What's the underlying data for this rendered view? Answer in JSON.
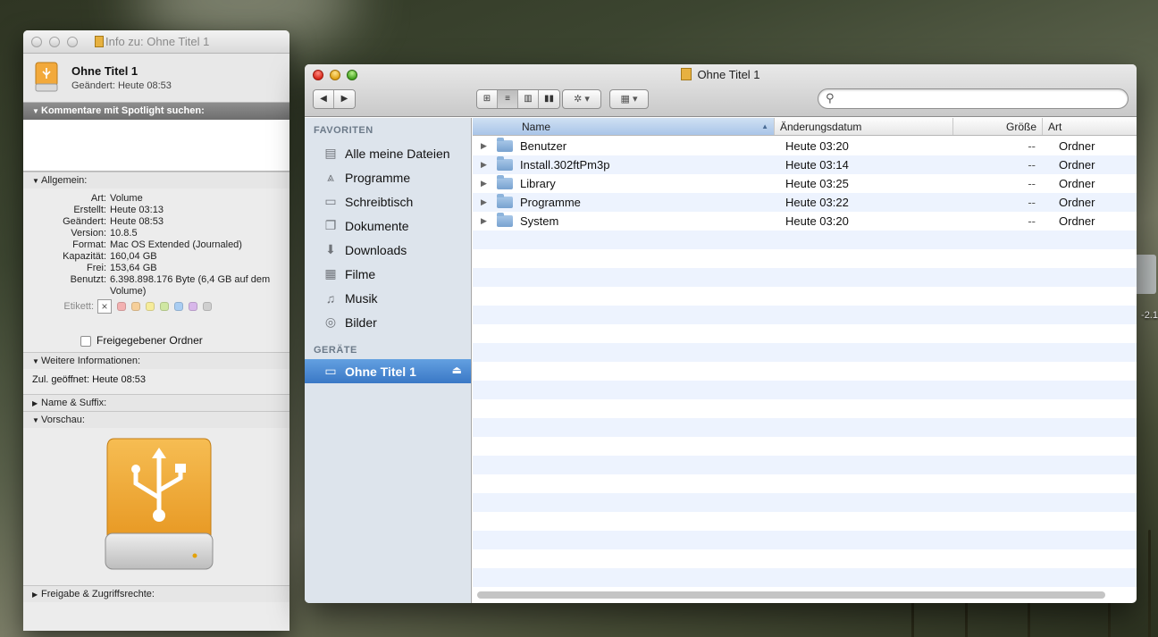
{
  "info_window": {
    "title": "Info zu: Ohne Titel 1",
    "name": "Ohne Titel 1",
    "modified": "Geändert:  Heute 08:53",
    "spotlight_header": "Kommentare mit Spotlight suchen:",
    "general_header": "Allgemein:",
    "general": [
      {
        "key": "Art:",
        "value": "Volume"
      },
      {
        "key": "Erstellt:",
        "value": "Heute 03:13"
      },
      {
        "key": "Geändert:",
        "value": "Heute 08:53"
      },
      {
        "key": "Version:",
        "value": "10.8.5"
      },
      {
        "key": "Format:",
        "value": "Mac OS Extended (Journaled)"
      },
      {
        "key": "Kapazität:",
        "value": "160,04 GB"
      },
      {
        "key": "Frei:",
        "value": "153,64 GB"
      },
      {
        "key": "Benutzt:",
        "value": "6.398.898.176 Byte (6,4 GB auf dem Volume)"
      }
    ],
    "label_key": "Etikett:",
    "label_colors": [
      "#f3b1b1",
      "#f6cf9a",
      "#f6ec9a",
      "#cfe7a2",
      "#a9cdf2",
      "#d8b7ea",
      "#cfcfcf"
    ],
    "shared_folder": "Freigegebener Ordner",
    "more_info_header": "Weitere Informationen:",
    "last_opened": "Zul. geöffnet: Heute 08:53",
    "name_suffix_header": "Name & Suffix:",
    "preview_header": "Vorschau:",
    "sharing_header": "Freigabe & Zugriffsrechte:",
    "drive_color": "#f2a93b"
  },
  "finder": {
    "title": "Ohne Titel 1",
    "search_placeholder": "",
    "sidebar": {
      "favorites_header": "FAVORITEN",
      "favorites": [
        {
          "label": "Alle meine Dateien",
          "icon": "all-files-icon"
        },
        {
          "label": "Programme",
          "icon": "applications-icon"
        },
        {
          "label": "Schreibtisch",
          "icon": "desktop-icon"
        },
        {
          "label": "Dokumente",
          "icon": "documents-icon"
        },
        {
          "label": "Downloads",
          "icon": "downloads-icon"
        },
        {
          "label": "Filme",
          "icon": "movies-icon"
        },
        {
          "label": "Musik",
          "icon": "music-icon"
        },
        {
          "label": "Bilder",
          "icon": "pictures-icon"
        }
      ],
      "devices_header": "GERÄTE",
      "devices": [
        {
          "label": "Ohne Titel 1",
          "icon": "drive-icon"
        }
      ]
    },
    "columns": {
      "name": "Name",
      "date": "Änderungsdatum",
      "size": "Größe",
      "kind": "Art"
    },
    "rows": [
      {
        "name": "Benutzer",
        "date": "Heute 03:20",
        "size": "--",
        "kind": "Ordner"
      },
      {
        "name": "Install.302ftPm3p",
        "date": "Heute 03:14",
        "size": "--",
        "kind": "Ordner"
      },
      {
        "name": "Library",
        "date": "Heute 03:25",
        "size": "--",
        "kind": "Ordner"
      },
      {
        "name": "Programme",
        "date": "Heute 03:22",
        "size": "--",
        "kind": "Ordner"
      },
      {
        "name": "System",
        "date": "Heute 03:20",
        "size": "--",
        "kind": "Ordner"
      }
    ],
    "selection_color": "#3a78c6"
  },
  "desktop": {
    "item_label": "-2.1"
  }
}
